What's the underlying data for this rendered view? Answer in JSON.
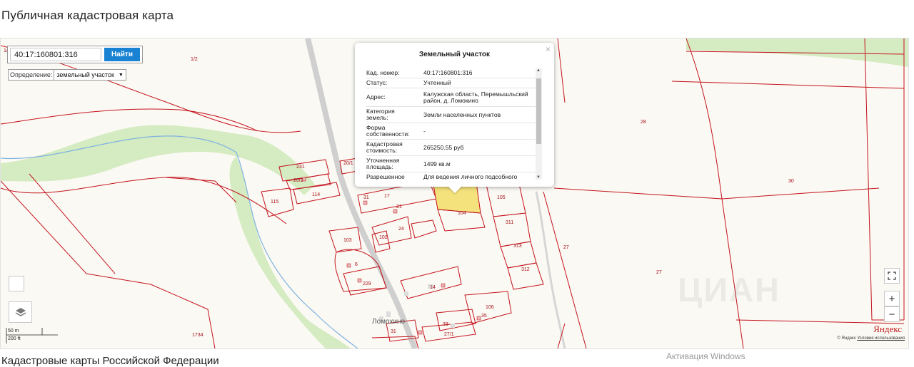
{
  "page": {
    "title": "Публичная кадастровая карта",
    "footer_title": "Кадастровые карты Российской Федерации",
    "windows_notice": "Активация Windows"
  },
  "search": {
    "value": "40:17:160801:316",
    "button_label": "Найти"
  },
  "definition": {
    "label": "Определение:",
    "selected": "земельный участок"
  },
  "popup": {
    "title": "Земельный участок",
    "rows": [
      {
        "key": "Кад. номер:",
        "value": "40:17:160801:316"
      },
      {
        "key": "Статус:",
        "value": "Учтенный"
      },
      {
        "key": "Адрес:",
        "value": "Калужская область, Перемышльский район, д. Ломокино"
      },
      {
        "key": "Категория земель:",
        "value": "Земли населенных пунктов"
      },
      {
        "key": "Форма собственности:",
        "value": "-"
      },
      {
        "key": "Кадастровая стоимость:",
        "value": "265250.55 руб"
      },
      {
        "key": "Уточненная площадь:",
        "value": "1499 кв.м"
      },
      {
        "key": "Разрешенное",
        "value": "Для ведения личного подсобного"
      }
    ]
  },
  "map": {
    "village": "Ломохино",
    "parcel_labels": [
      "1/2",
      "231",
      "20/1",
      "20/2",
      "114",
      "115",
      "31",
      "17",
      "21",
      "104",
      "105",
      "311",
      "313",
      "312",
      "24",
      "103",
      "102",
      "6",
      "229",
      "14",
      "106",
      "35",
      "33",
      "27/1",
      "31",
      "28",
      "30",
      "27",
      "27",
      "1734"
    ],
    "corner_label": "1/",
    "scale_metric": "50 m",
    "scale_imperial": "200 ft",
    "brand": "Яндекс",
    "copyright": "© Яндекс",
    "terms_link": "Условия использования",
    "watermark": "ЦИАН"
  },
  "controls": {
    "zoom_in": "+",
    "zoom_out": "−",
    "fullscreen_icon": "fullscreen-icon",
    "layers_icon": "layers-icon"
  },
  "colors": {
    "parcel_line": "#c4141e",
    "green_zone": "#d5ebc2",
    "river": "#7fb3e0",
    "selected_parcel": "#f4e27c",
    "search_button": "#1a82d2"
  }
}
